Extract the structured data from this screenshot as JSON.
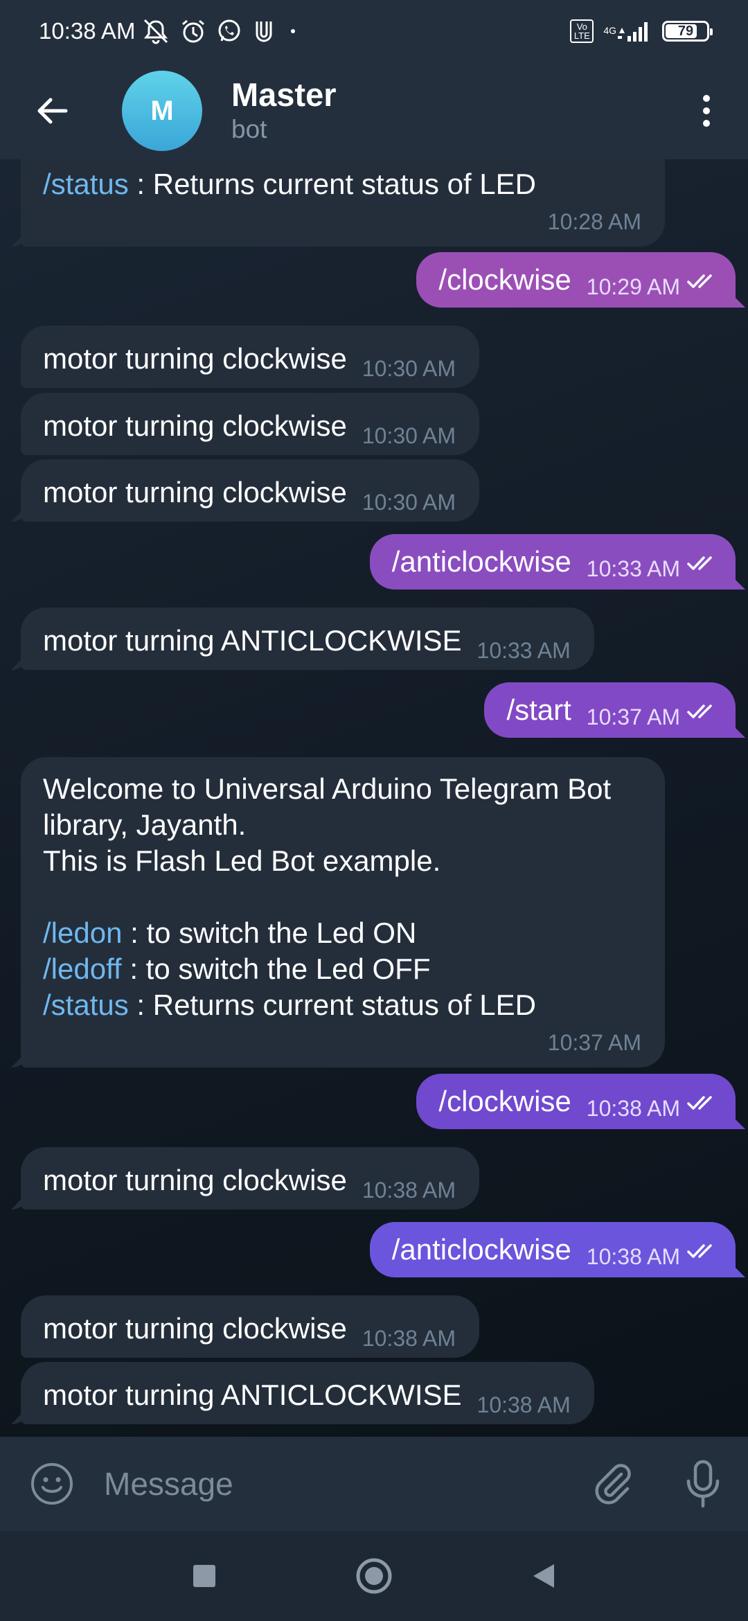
{
  "status_bar": {
    "time": "10:38 AM",
    "icons": [
      "mute-icon",
      "alarm-icon",
      "whatsapp-icon",
      "app-icon",
      "dot-icon"
    ],
    "volte": "Vo LTE",
    "network": "4G",
    "battery_percent": "79",
    "battery_level": 0.79
  },
  "header": {
    "back_icon": "arrow-left-icon",
    "avatar_letter": "M",
    "title": "Master",
    "subtitle": "bot",
    "menu_icon": "more-vertical-icon"
  },
  "messages": [
    {
      "side": "in",
      "cmd": "/status",
      "text": " : Returns current status of LED",
      "time": "10:28 AM"
    },
    {
      "side": "out",
      "text": "/clockwise",
      "time": "10:29 AM",
      "color": "#9b4fb5"
    },
    {
      "side": "in",
      "text": "motor turning clockwise",
      "time": "10:30 AM"
    },
    {
      "side": "in",
      "text": "motor turning clockwise",
      "time": "10:30 AM"
    },
    {
      "side": "in",
      "text": "motor turning clockwise",
      "time": "10:30 AM"
    },
    {
      "side": "out",
      "text": "/anticlockwise",
      "time": "10:33 AM",
      "color": "#8a4dc0"
    },
    {
      "side": "in",
      "text": "motor turning ANTICLOCKWISE",
      "time": "10:33 AM"
    },
    {
      "side": "out",
      "text": "/start",
      "time": "10:37 AM",
      "color": "#8249c6"
    },
    {
      "side": "in",
      "line1": "Welcome to Universal Arduino Telegram Bot",
      "line2": "library, Jayanth.",
      "line3": "This is Flash Led Bot example.",
      "cmd_ledon": "/ledon",
      "text_ledon": " : to switch the Led ON",
      "cmd_ledoff": "/ledoff",
      "text_ledoff": " : to switch the Led OFF",
      "cmd_status": "/status",
      "text_status": " : Returns current status of LED",
      "time": "10:37 AM"
    },
    {
      "side": "out",
      "text": "/clockwise",
      "time": "10:38 AM",
      "color": "#7049cf"
    },
    {
      "side": "in",
      "text": "motor turning clockwise",
      "time": "10:38 AM"
    },
    {
      "side": "out",
      "text": "/anticlockwise",
      "time": "10:38 AM",
      "color": "#6a55dc"
    },
    {
      "side": "in",
      "text": "motor turning clockwise",
      "time": "10:38 AM"
    },
    {
      "side": "in",
      "text": "motor turning ANTICLOCKWISE",
      "time": "10:38 AM"
    }
  ],
  "input_bar": {
    "emoji_icon": "smile-icon",
    "placeholder": "Message",
    "attach_icon": "paperclip-icon",
    "mic_icon": "microphone-icon"
  },
  "nav_bar": {
    "icons": [
      "recents-square-icon",
      "home-circle-icon",
      "back-triangle-icon"
    ]
  },
  "colors": {
    "header_bg": "#242f3d",
    "incoming_bubble": "#242e3b",
    "command_link": "#6fb8ef",
    "avatar_gradient_top": "#5fd3ea"
  }
}
